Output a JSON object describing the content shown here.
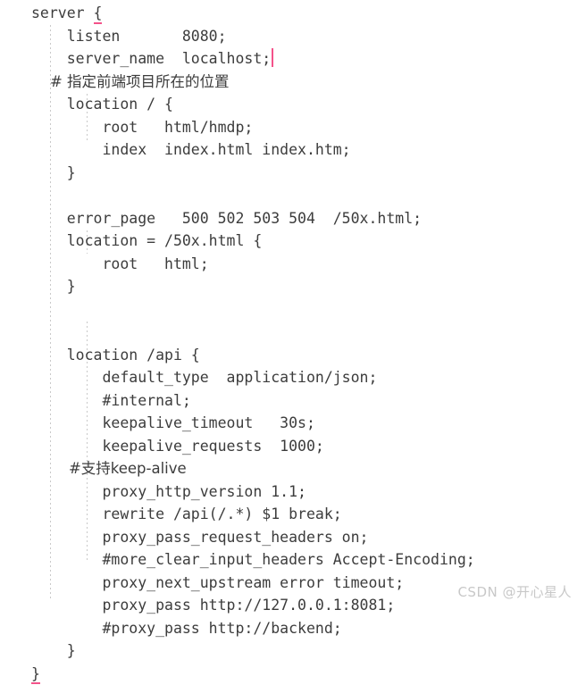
{
  "editor": {
    "language": "nginx",
    "background_color": "#ffffff",
    "text_color": "#3c3c3c",
    "caret_color": "#f4528a",
    "brace_match_color": "#f4528a",
    "indent_guide_color": "#c9c9c9",
    "lines": [
      "server {",
      "    listen       8080;",
      "    server_name  localhost;",
      "    # 指定前端项目所在的位置",
      "    location / {",
      "        root   html/hmdp;",
      "        index  index.html index.htm;",
      "    }",
      "",
      "    error_page   500 502 503 504  /50x.html;",
      "    location = /50x.html {",
      "        root   html;",
      "    }",
      "",
      "",
      "    location /api {",
      "        default_type  application/json;",
      "        #internal;",
      "        keepalive_timeout   30s;",
      "        keepalive_requests  1000;",
      "        #支持keep-alive",
      "        proxy_http_version 1.1;",
      "        rewrite /api(/.*) $1 break;",
      "        proxy_pass_request_headers on;",
      "        #more_clear_input_headers Accept-Encoding;",
      "        proxy_next_upstream error timeout;",
      "        proxy_pass http://127.0.0.1:8081;",
      "        #proxy_pass http://backend;",
      "    }",
      "}"
    ],
    "segments": {
      "l1_server": "server ",
      "l1_brace": "{",
      "l2_listen": "    listen       8080;",
      "l3_server_name": "    server_name  localhost;",
      "l4_comment": "    # 指定前端项目所在的位置",
      "l5_location_root": "    location / {",
      "l6_root": "        root   html/hmdp;",
      "l7_index": "        index  index.html index.htm;",
      "l8_close": "    }",
      "l10_error_page": "    error_page   500 502 503 504  /50x.html;",
      "l11_location_50x": "    location = /50x.html {",
      "l12_root": "        root   html;",
      "l13_close": "    }",
      "l16_location_api": "    location /api {",
      "l17_default_type": "        default_type  application/json;",
      "l18_internal": "        #internal;",
      "l19_keepalive_timeout": "        keepalive_timeout   30s;",
      "l20_keepalive_requests": "        keepalive_requests  1000;",
      "l21_comment_keepalive": "        #支持keep-alive",
      "l22_proxy_http_version": "        proxy_http_version 1.1;",
      "l23_rewrite": "        rewrite /api(/.*) $1 break;",
      "l24_proxy_pass_request_headers": "        proxy_pass_request_headers on;",
      "l25_more_clear_input_headers": "        #more_clear_input_headers Accept-Encoding;",
      "l26_proxy_next_upstream": "        proxy_next_upstream error timeout;",
      "l27_proxy_pass": "        proxy_pass http://127.0.0.1:8081;",
      "l28_proxy_pass_backend": "        #proxy_pass http://backend;",
      "l29_close": "    }",
      "l30_brace": "}"
    }
  },
  "watermark": {
    "text": "CSDN @开心星人"
  }
}
